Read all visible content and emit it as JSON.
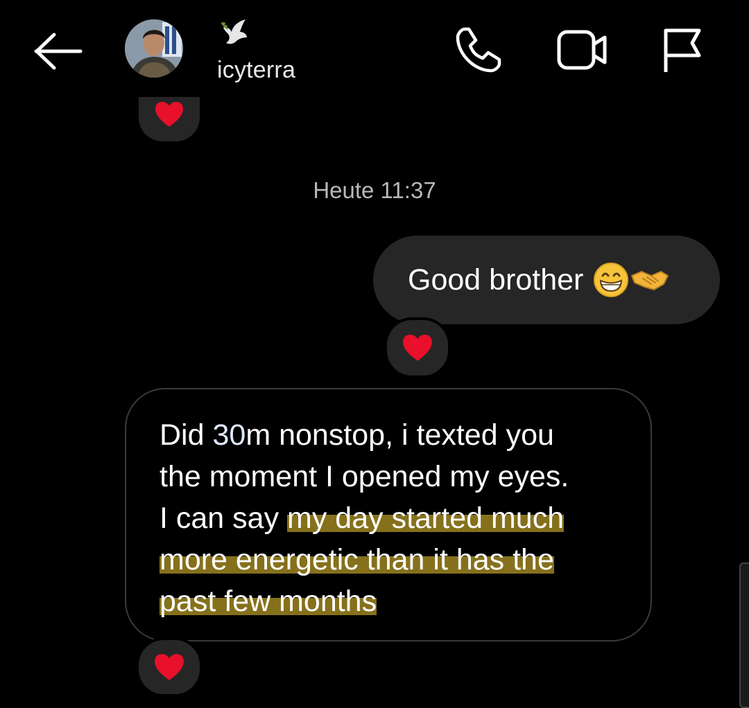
{
  "header": {
    "username": "icyterra",
    "status_emoji": "dove-emoji",
    "icons": [
      "back-arrow-icon",
      "phone-icon",
      "video-camera-icon",
      "flag-icon"
    ]
  },
  "thread": {
    "timestamp": "Heute 11:37",
    "outgoing": {
      "text": "Good brother",
      "emojis": [
        "grinning-face-emoji",
        "handshake-emoji"
      ],
      "reaction": "red-heart"
    },
    "incoming": {
      "line1a": "Did ",
      "line1b": "30",
      "line1c": "m nonstop, i texted you",
      "line2": "the moment I opened my eyes.",
      "line3a": "I can say ",
      "line3b": "my day started much",
      "line4": "more energetic than it has the",
      "line5": "past few months",
      "reaction": "red-heart"
    }
  },
  "colors": {
    "background": "#000000",
    "bubble": "#262626",
    "highlight": "#bea028",
    "heart": "#e8102a"
  }
}
